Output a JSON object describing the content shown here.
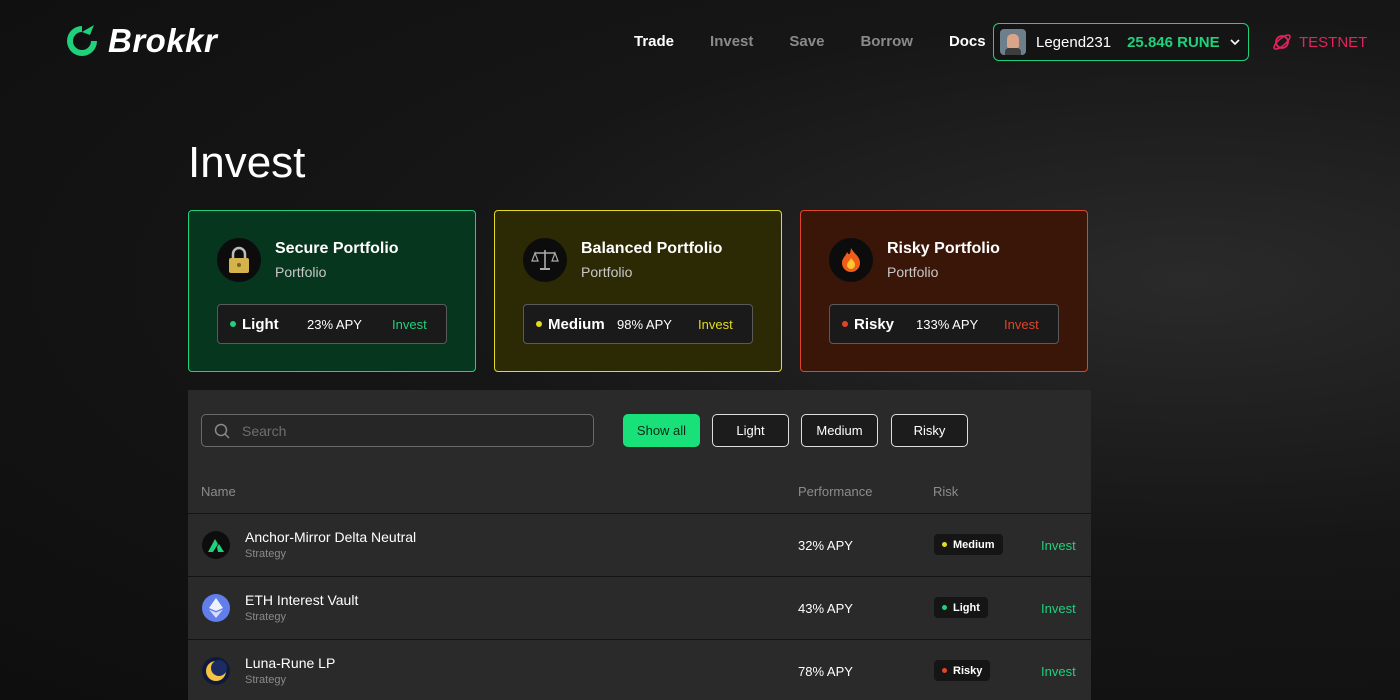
{
  "header": {
    "brand": "Brokkr",
    "nav": [
      {
        "label": "Trade"
      },
      {
        "label": "Invest"
      },
      {
        "label": "Save"
      },
      {
        "label": "Borrow"
      },
      {
        "label": "Docs"
      }
    ],
    "account": {
      "username": "Legend231",
      "balance": "25.846 RUNE"
    },
    "network": "TESTNET"
  },
  "page": {
    "title": "Invest"
  },
  "portfolios": [
    {
      "title": "Secure Portfolio",
      "subtitle": "Portfolio",
      "icon": "lock-icon",
      "level": "Light",
      "apy": "23% APY",
      "action": "Invest",
      "color": "#1fd17b"
    },
    {
      "title": "Balanced Portfolio",
      "subtitle": "Portfolio",
      "icon": "scales-icon",
      "level": "Medium",
      "apy": "98% APY",
      "action": "Invest",
      "color": "#e3db1e"
    },
    {
      "title": "Risky Portfolio",
      "subtitle": "Portfolio",
      "icon": "fire-icon",
      "level": "Risky",
      "apy": "133% APY",
      "action": "Invest",
      "color": "#e0452a"
    }
  ],
  "filters": {
    "search_placeholder": "Search",
    "buttons": [
      {
        "label": "Show all",
        "active": true
      },
      {
        "label": "Light"
      },
      {
        "label": "Medium"
      },
      {
        "label": "Risky"
      }
    ]
  },
  "table": {
    "headers": {
      "name": "Name",
      "performance": "Performance",
      "risk": "Risk"
    },
    "rows": [
      {
        "name": "Anchor-Mirror Delta Neutral",
        "type": "Strategy",
        "performance": "32% APY",
        "risk": "Medium",
        "risk_color": "#e3db1e",
        "action": "Invest",
        "icon": "anchor-icon"
      },
      {
        "name": "ETH Interest Vault",
        "type": "Strategy",
        "performance": "43% APY",
        "risk": "Light",
        "risk_color": "#1fd17b",
        "action": "Invest",
        "icon": "ethereum-icon"
      },
      {
        "name": "Luna-Rune LP",
        "type": "Strategy",
        "performance": "78% APY",
        "risk": "Risky",
        "risk_color": "#e0452a",
        "action": "Invest",
        "icon": "luna-icon"
      }
    ]
  }
}
